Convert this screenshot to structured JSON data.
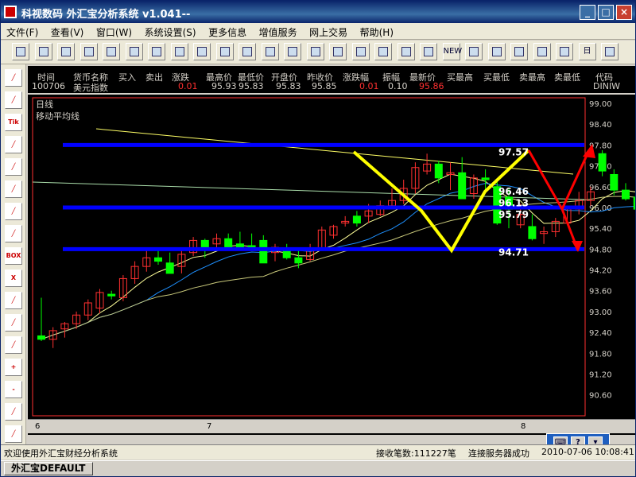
{
  "window": {
    "title": "科视数码  外汇宝分析系统  v1.041--",
    "min_glyph": "_",
    "max_glyph": "□",
    "close_glyph": "×"
  },
  "menu": [
    "文件(F)",
    "查看(V)",
    "窗口(W)",
    "系统设置(S)",
    "更多信息",
    "增值服务",
    "网上交易",
    "帮助(H)"
  ],
  "toolbar_icons": [
    "new-icon",
    "open-icon",
    "folder-icon",
    "save-icon",
    "copy-icon",
    "paste-icon",
    "print-icon",
    "grid-icon",
    "table-icon",
    "layout-icon",
    "window-icon",
    "chart-icon",
    "report-icon",
    "book-icon",
    "trend-icon",
    "cursor-icon",
    "grid2-icon",
    "clock-icon",
    "calc-icon",
    "news-icon",
    "up-icon",
    "down-icon",
    "doc-icon",
    "warning-icon",
    "chart2-icon",
    "day-icon",
    "tile-icon"
  ],
  "toolbar_labels": {
    "day": "日",
    "new_badge": "NEW"
  },
  "left_tools": [
    {
      "name": "line-tool-icon",
      "label": ""
    },
    {
      "name": "fan-tool-icon",
      "label": ""
    },
    {
      "name": "tik-tool-icon",
      "label": "Tik"
    },
    {
      "name": "channel-tool-icon",
      "label": ""
    },
    {
      "name": "arrow-tool-icon",
      "label": ""
    },
    {
      "name": "pen-tool-icon",
      "label": ""
    },
    {
      "name": "draw-tool-icon",
      "label": ""
    },
    {
      "name": "fib-tool-icon",
      "label": ""
    },
    {
      "name": "box-tool-icon",
      "label": "BOX"
    },
    {
      "name": "delete-tool-icon",
      "label": "X"
    },
    {
      "name": "eraser-tool-icon",
      "label": ""
    },
    {
      "name": "zoom-tool-icon",
      "label": ""
    },
    {
      "name": "curve-tool-icon",
      "label": ""
    },
    {
      "name": "zoom-in-tool-icon",
      "label": "+"
    },
    {
      "name": "zoom-out-tool-icon",
      "label": "-"
    },
    {
      "name": "trend-tool-icon",
      "label": ""
    },
    {
      "name": "calc-tool-icon",
      "label": ""
    }
  ],
  "quote": {
    "headers": [
      "时间",
      "货币名称",
      "买入",
      "卖出",
      "涨跌",
      "最高价",
      "最低价",
      "开盘价",
      "昨收价",
      "涨跌幅",
      "振幅",
      "最新价",
      "买最高",
      "买最低",
      "卖最高",
      "卖最低",
      "代码"
    ],
    "time": "100706",
    "currency_name": "美元指数",
    "change": "0.01",
    "high": "95.93",
    "low": "95.83",
    "open": "95.83",
    "prev_close": "95.85",
    "change_pct": "0.01",
    "amplitude": "0.10",
    "latest": "95.86",
    "code": "DINIW"
  },
  "chart_labels": {
    "period": "日线",
    "indicator": "移动平均线"
  },
  "price_axis": [
    "99.00",
    "98.40",
    "97.80",
    "97.20",
    "96.60",
    "96.00",
    "95.40",
    "94.80",
    "94.20",
    "93.60",
    "93.00",
    "92.40",
    "91.80",
    "91.20",
    "90.60"
  ],
  "price_annotations": [
    "97.57",
    "96.46",
    "96.13",
    "95.79",
    "94.71"
  ],
  "x_axis_labels": [
    "6",
    "7",
    "8"
  ],
  "colors": {
    "up_candle": "#ff3030",
    "down_candle": "#00ff00",
    "support_line": "#0000ff",
    "w_pattern": "#ffff00",
    "forecast": "#ff0000",
    "ma_short": "#ffff99",
    "ma_mid": "#1e90ff",
    "ma_long": "#c8c87a"
  },
  "chart_data": {
    "type": "candlestick",
    "period": "日线",
    "ylim": [
      90.6,
      99.0
    ],
    "hlines": [
      97.8,
      96.0,
      94.8
    ],
    "candles": [
      [
        92.3,
        93.4,
        92.15,
        92.2
      ],
      [
        92.2,
        92.55,
        91.95,
        92.45
      ],
      [
        92.5,
        92.7,
        92.25,
        92.65
      ],
      [
        92.65,
        93.0,
        92.5,
        92.9
      ],
      [
        92.9,
        93.35,
        92.75,
        93.25
      ],
      [
        93.1,
        93.65,
        92.95,
        93.55
      ],
      [
        93.5,
        93.6,
        93.35,
        93.45
      ],
      [
        93.4,
        94.05,
        93.3,
        93.95
      ],
      [
        93.95,
        94.45,
        93.8,
        94.3
      ],
      [
        94.3,
        94.8,
        94.15,
        94.55
      ],
      [
        94.55,
        94.75,
        94.35,
        94.45
      ],
      [
        94.4,
        94.7,
        94.1,
        94.1
      ],
      [
        94.3,
        94.75,
        94.1,
        94.65
      ],
      [
        94.7,
        95.15,
        94.6,
        95.05
      ],
      [
        95.05,
        95.1,
        94.55,
        94.8
      ],
      [
        94.95,
        95.25,
        94.8,
        95.1
      ],
      [
        95.1,
        95.25,
        94.75,
        94.8
      ],
      [
        94.95,
        95.3,
        94.75,
        94.8
      ],
      [
        94.9,
        95.25,
        94.8,
        94.85
      ],
      [
        95.05,
        95.2,
        94.4,
        94.4
      ],
      [
        94.7,
        94.95,
        94.45,
        94.85
      ],
      [
        94.75,
        94.95,
        94.5,
        94.55
      ],
      [
        94.55,
        94.8,
        94.25,
        94.4
      ],
      [
        94.5,
        94.95,
        94.45,
        94.8
      ],
      [
        94.8,
        95.45,
        94.75,
        95.35
      ],
      [
        95.2,
        95.5,
        95.1,
        95.45
      ],
      [
        95.55,
        95.75,
        95.45,
        95.6
      ],
      [
        95.75,
        95.9,
        95.45,
        95.55
      ],
      [
        95.75,
        96.1,
        95.55,
        95.9
      ],
      [
        95.8,
        96.2,
        95.75,
        96.05
      ],
      [
        96.05,
        96.55,
        95.95,
        96.2
      ],
      [
        96.2,
        96.8,
        96.1,
        96.55
      ],
      [
        96.55,
        97.3,
        96.4,
        97.15
      ],
      [
        97.05,
        97.55,
        96.95,
        97.25
      ],
      [
        97.25,
        97.35,
        96.7,
        96.85
      ],
      [
        96.95,
        97.3,
        96.5,
        97.0
      ],
      [
        97.0,
        97.45,
        96.4,
        96.25
      ],
      [
        96.4,
        96.95,
        96.25,
        96.85
      ],
      [
        96.85,
        97.1,
        96.5,
        96.8
      ],
      [
        96.6,
        96.75,
        95.5,
        95.55
      ],
      [
        96.3,
        96.55,
        95.4,
        95.95
      ],
      [
        95.5,
        96.1,
        95.4,
        95.8
      ],
      [
        95.45,
        95.8,
        95.05,
        95.1
      ],
      [
        95.25,
        95.45,
        94.95,
        95.3
      ],
      [
        95.3,
        95.7,
        95.15,
        95.6
      ],
      [
        95.55,
        96.0,
        95.5,
        95.95
      ],
      [
        95.95,
        96.45,
        95.8,
        96.2
      ],
      [
        96.2,
        96.6,
        96.05,
        96.45
      ],
      [
        97.55,
        97.65,
        96.9,
        97.05
      ],
      [
        96.95,
        97.1,
        96.35,
        96.5
      ],
      [
        96.5,
        96.7,
        96.2,
        96.25
      ],
      [
        96.3,
        96.4,
        95.85,
        95.95
      ]
    ],
    "annotated_levels": [
      97.57,
      96.46,
      96.13,
      95.79,
      94.71
    ]
  },
  "status": {
    "welcome": "欢迎使用外汇宝财经分析系统",
    "records": "接收笔数:111227笔",
    "server": "连接服务器成功",
    "datetime": "2010-07-06 10:08:41"
  },
  "taskbar": {
    "task": "外汇宝DEFAULT"
  }
}
